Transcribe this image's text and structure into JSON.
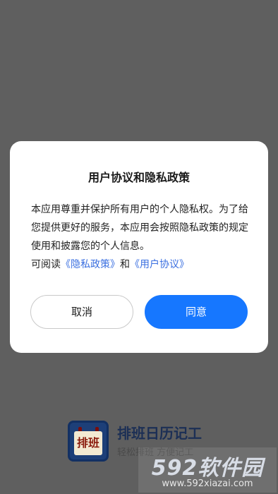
{
  "splash": {
    "icon_text": "排班",
    "app_name": "排班日历记工",
    "slogan": "轻松排班 方便记工"
  },
  "dialog": {
    "title": "用户协议和隐私政策",
    "body": "本应用尊重并保护所有用户的个人隐私权。为了给您提供更好的服务，本应用会按照隐私政策的规定使用和披露您的个人信息。",
    "read_prefix": "可阅读",
    "privacy_link": "《隐私政策》",
    "and_text": "和",
    "agreement_link": "《用户协议》",
    "cancel_label": "取消",
    "agree_label": "同意"
  },
  "watermark": {
    "main": "592软件园",
    "url": "www.592xiazai.com"
  },
  "colors": {
    "overlay_bg": "#5f5f5f",
    "primary_button": "#1677ff",
    "link": "#3a6fe0"
  }
}
